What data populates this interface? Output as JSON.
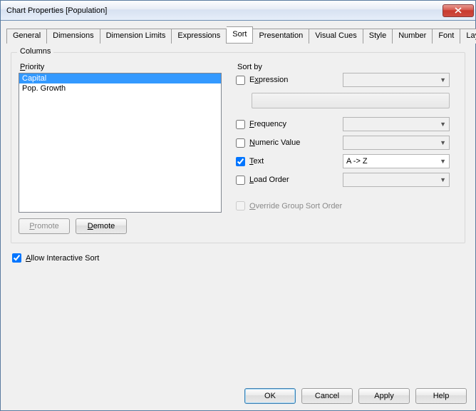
{
  "window": {
    "title": "Chart Properties [Population]"
  },
  "tabs": {
    "items": [
      "General",
      "Dimensions",
      "Dimension Limits",
      "Expressions",
      "Sort",
      "Presentation",
      "Visual Cues",
      "Style",
      "Number",
      "Font",
      "Layo"
    ],
    "active_index": 4
  },
  "columns": {
    "legend": "Columns",
    "priority_label": "Priority",
    "items": [
      "Capital",
      "Pop. Growth"
    ],
    "selected_index": 0,
    "promote": "Promote",
    "demote": "Demote"
  },
  "sortby": {
    "label": "Sort by",
    "expression": {
      "label_pre": "E",
      "label_ul": "x",
      "label_post": "pression",
      "checked": false,
      "combo": ""
    },
    "frequency": {
      "label_ul": "F",
      "label_post": "requency",
      "checked": false,
      "combo": ""
    },
    "numeric": {
      "label_ul": "N",
      "label_post": "umeric Value",
      "checked": false,
      "combo": ""
    },
    "text": {
      "label_ul": "T",
      "label_post": "ext",
      "checked": true,
      "combo": "A -> Z"
    },
    "loadorder": {
      "label_ul": "L",
      "label_post": "oad Order",
      "checked": false,
      "combo": ""
    },
    "override": {
      "label_ul": "O",
      "label_post": "verride Group Sort Order",
      "checked": false
    }
  },
  "allow_interactive": {
    "label_ul": "A",
    "label_post": "llow Interactive Sort",
    "checked": true
  },
  "footer": {
    "ok": "OK",
    "cancel": "Cancel",
    "apply": "Apply",
    "help": "Help"
  }
}
